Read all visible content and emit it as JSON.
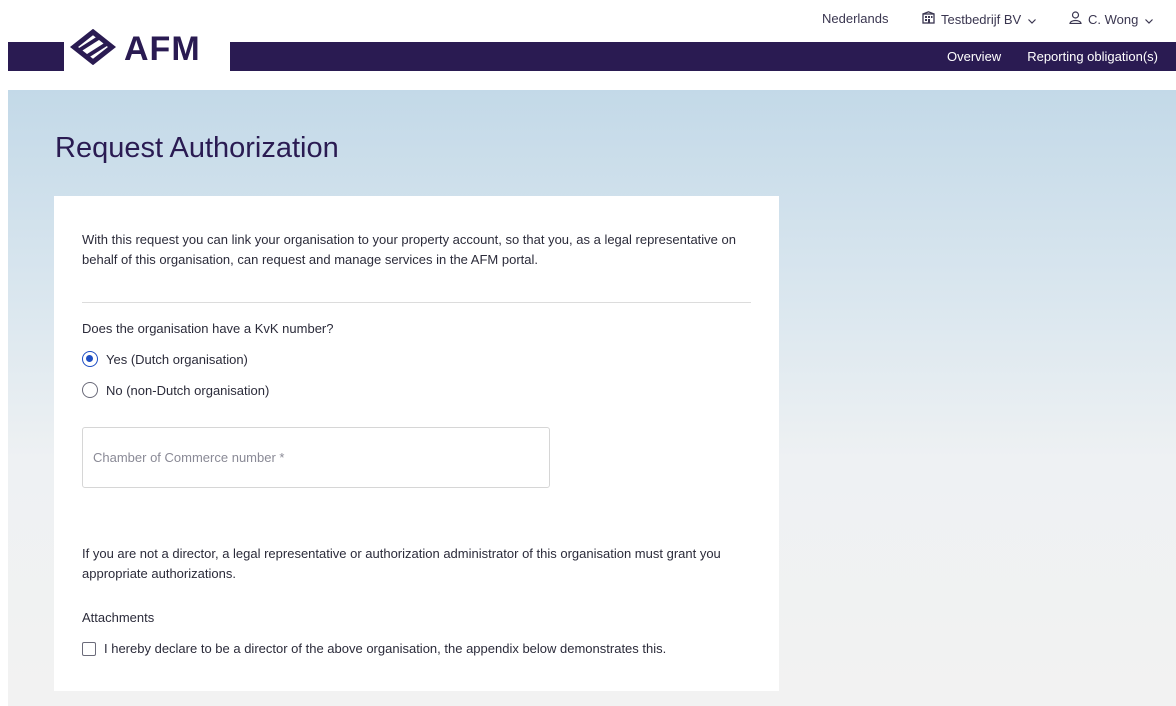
{
  "header": {
    "language": "Nederlands",
    "company": "Testbedrijf BV",
    "user": "C. Wong",
    "logo_text": "AFM",
    "nav": [
      {
        "label": "Overview"
      },
      {
        "label": "Reporting obligation(s)"
      }
    ]
  },
  "page": {
    "title": "Request Authorization"
  },
  "form": {
    "intro": "With this request you can link your organisation to your property account, so that you, as a legal representative on behalf of this organisation, can request and manage services in the AFM portal.",
    "kvk_question": "Does the organisation have a KvK number?",
    "radio_options": [
      {
        "label": "Yes (Dutch organisation)",
        "checked": true
      },
      {
        "label": "No (non-Dutch organisation)",
        "checked": false
      }
    ],
    "kvk_placeholder": "Chamber of Commerce number *",
    "kvk_value": "",
    "note": "If you are not a director, a legal representative or authorization administrator of this organisation must grant you appropriate authorizations.",
    "attachments_label": "Attachments",
    "declaration": "I hereby declare to be a director of the above organisation, the appendix below demonstrates this."
  },
  "colors": {
    "brand": "#2a1b52",
    "radio_accent": "#1f4fc4"
  }
}
